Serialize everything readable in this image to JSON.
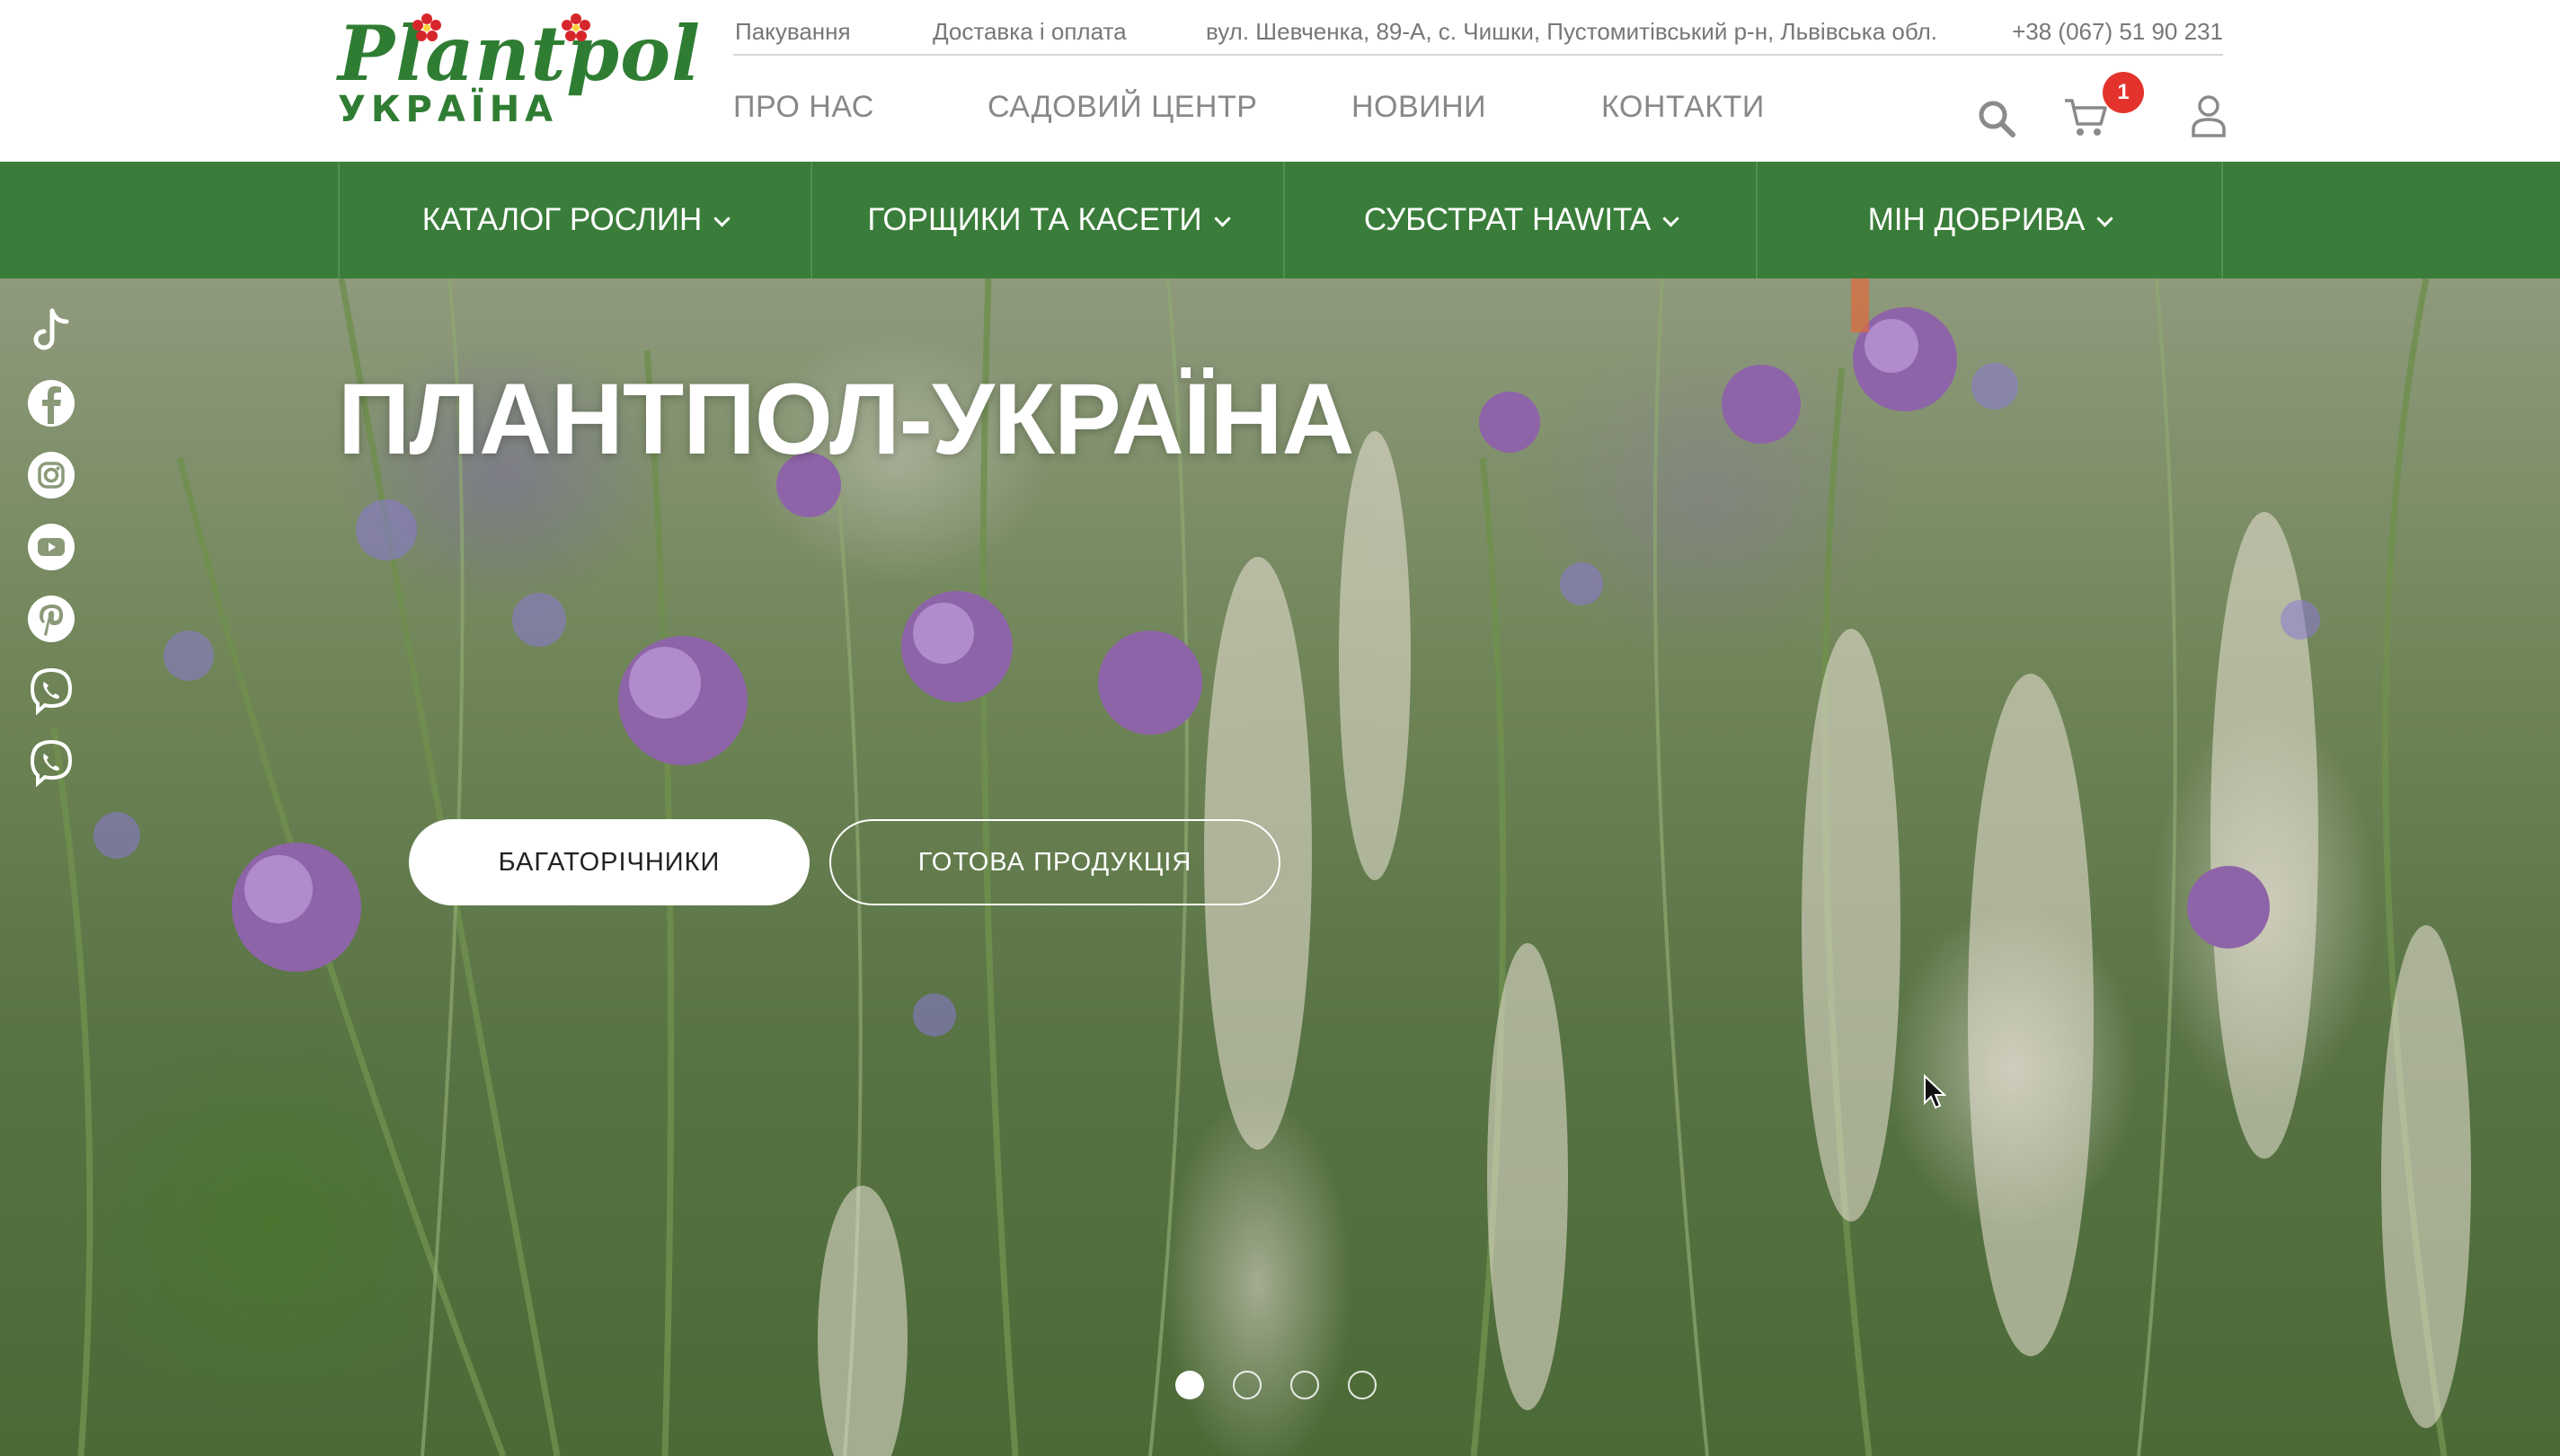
{
  "brand": {
    "logo_word": "Plantpol",
    "logo_sub": "УКРАЇНА",
    "green": "#2f7d33",
    "accent_red": "#e3332c"
  },
  "topbar": {
    "packaging": "Пакування",
    "delivery": "Доставка і оплата",
    "address": "вул. Шевченка, 89-А, с. Чишки, Пустомитівський р-н, Львівська обл.",
    "phone": "+38 (067) 51 90 231"
  },
  "mainnav": {
    "about": "ПРО НАС",
    "garden_center": "САДОВИЙ ЦЕНТР",
    "news": "НОВИНИ",
    "contacts": "КОНТАКТИ"
  },
  "header_icons": {
    "search": "search-icon",
    "cart": "cart-icon",
    "cart_count": "1",
    "user": "user-icon"
  },
  "categories": [
    {
      "label": "КАТАЛОГ РОСЛИН"
    },
    {
      "label": "ГОРЩИКИ ТА КАСЕТИ"
    },
    {
      "label": "СУБСТРАТ HAWITA"
    },
    {
      "label": "МІН ДОБРИВА"
    }
  ],
  "category_bar_color": "#3a7d3a",
  "hero": {
    "title": "ПЛАНТПОЛ-УКРАЇНА",
    "primary_button": "БАГАТОРІЧНИКИ",
    "secondary_button": "ГОТОВА ПРОДУКЦІЯ",
    "slides_total": 4,
    "active_slide": 1
  },
  "socials": [
    "tiktok-icon",
    "facebook-icon",
    "instagram-icon",
    "youtube-icon",
    "pinterest-icon",
    "viber-icon",
    "viber-icon"
  ]
}
